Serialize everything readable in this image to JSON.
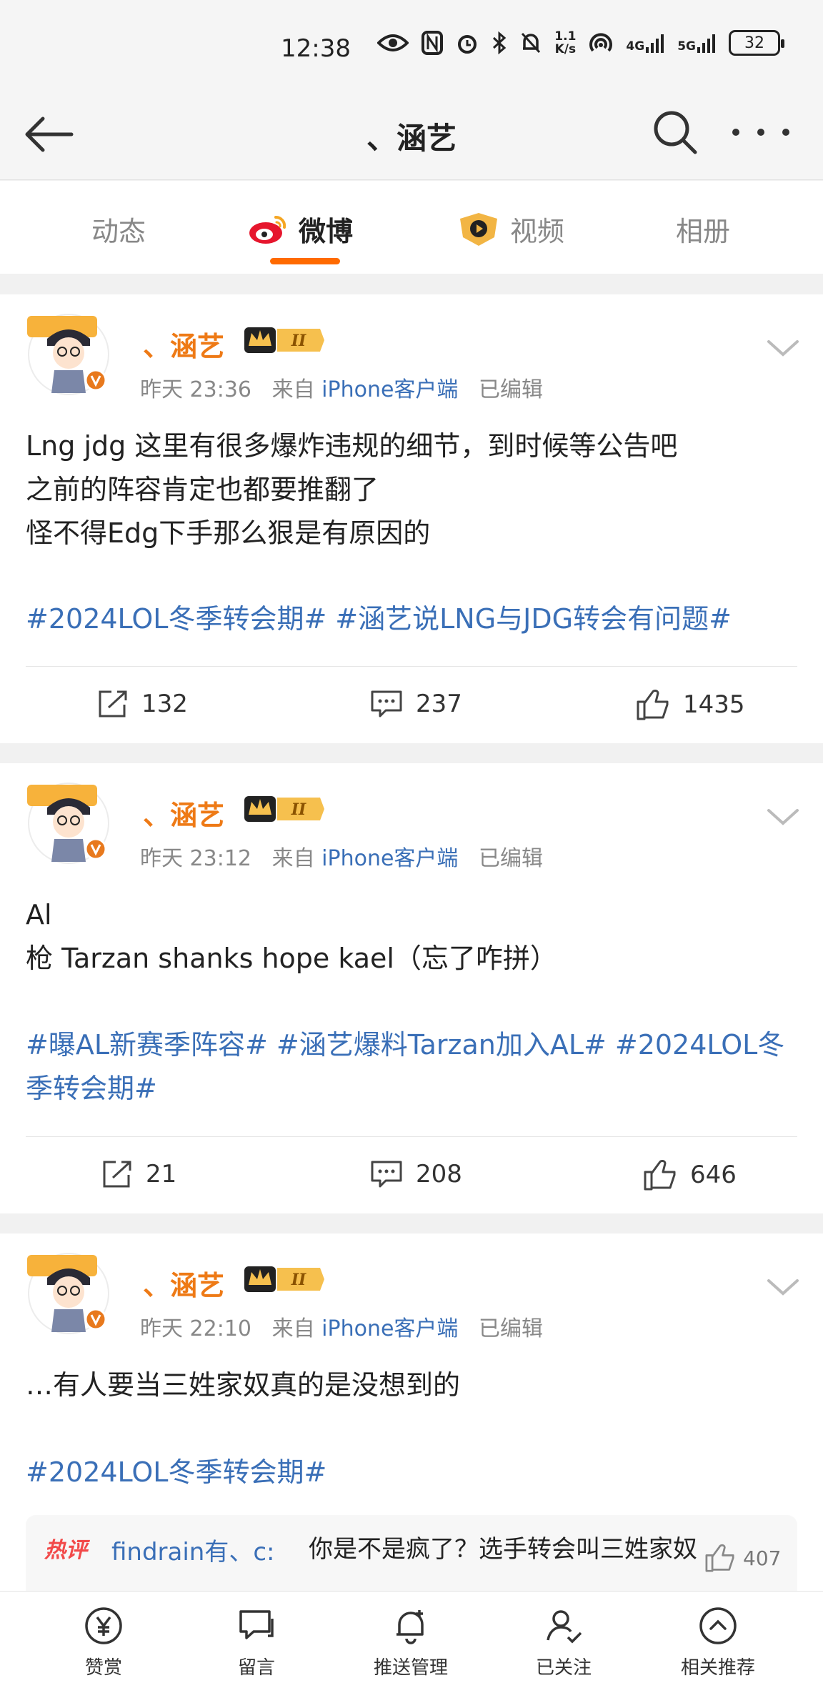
{
  "status_bar": {
    "time": "12:38",
    "net_speed": "1.1\nK/s",
    "net1": "4G",
    "net2": "5G",
    "battery": "32"
  },
  "nav": {
    "title": "、涵艺"
  },
  "tabs": [
    {
      "label": "动态"
    },
    {
      "label": "微博"
    },
    {
      "label": "视频"
    },
    {
      "label": "相册"
    }
  ],
  "badge_level": "II",
  "posts": [
    {
      "username": "、涵艺",
      "time": "昨天 23:36",
      "from": "来自",
      "source": "iPhone客户端",
      "edited": "已编辑",
      "text": "Lng jdg 这里有很多爆炸违规的细节，到时候等公告吧\n之前的阵容肯定也都要推翻了\n怪不得Edg下手那么狠是有原因的",
      "topics": [
        "#2024LOL冬季转会期#",
        "#涵艺说LNG与JDG转会有问题#"
      ],
      "reposts": "132",
      "comments": "237",
      "likes": "1435"
    },
    {
      "username": "、涵艺",
      "time": "昨天 23:12",
      "from": "来自",
      "source": "iPhone客户端",
      "edited": "已编辑",
      "text": "Al\n枪 Tarzan shanks hope kael（忘了咋拼）",
      "topics": [
        "#曝AL新赛季阵容#",
        "#涵艺爆料Tarzan加入AL#",
        "#2024LOL冬季转会期#"
      ],
      "reposts": "21",
      "comments": "208",
      "likes": "646"
    },
    {
      "username": "、涵艺",
      "time": "昨天 22:10",
      "from": "来自",
      "source": "iPhone客户端",
      "edited": "已编辑",
      "text": "…有人要当三姓家奴真的是没想到的",
      "topics": [
        "#2024LOL冬季转会期#"
      ],
      "hot_comment": {
        "tag": "热评",
        "user": "findrain有、c:",
        "text": "你是不是疯了？选手转会叫三姓家奴",
        "likes": "407"
      }
    }
  ],
  "bottom_bar": [
    {
      "label": "赞赏",
      "icon": "yen-icon"
    },
    {
      "label": "留言",
      "icon": "chat-icon"
    },
    {
      "label": "推送管理",
      "icon": "bell-icon"
    },
    {
      "label": "已关注",
      "icon": "user-check-icon"
    },
    {
      "label": "相关推荐",
      "icon": "chevron-up-icon"
    }
  ]
}
